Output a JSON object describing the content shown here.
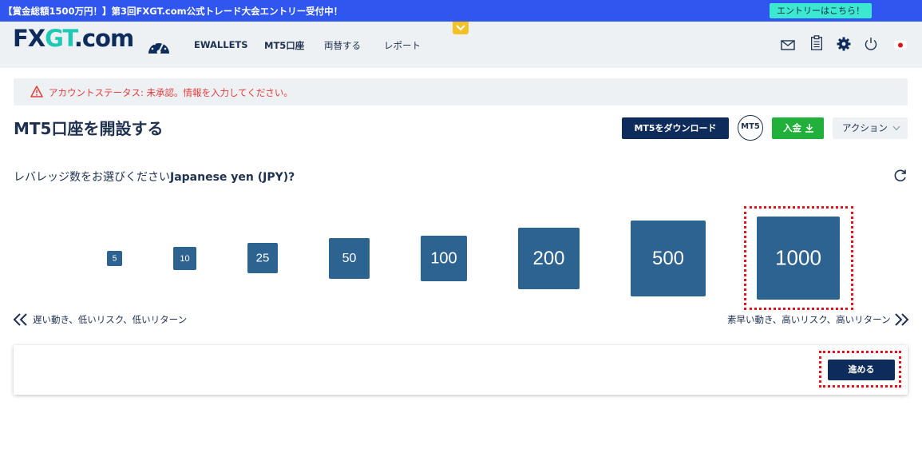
{
  "banner": {
    "text": "【賞金総額1500万円！】第3回FXGT.com公式トレード大会エントリー受付中！",
    "entry_button": "エントリーはこちら！"
  },
  "navbar": {
    "logo": {
      "fx": "FX",
      "gt": "GT",
      "com": ".com"
    },
    "items": [
      {
        "label": "EWALLETS"
      },
      {
        "label": "MT5口座"
      },
      {
        "label": "両替する"
      },
      {
        "label": "レポート"
      }
    ],
    "icons": [
      "dashboard-gauge-icon",
      "mail-icon",
      "clipboard-icon",
      "gear-icon",
      "power-icon",
      "japan-flag-icon"
    ]
  },
  "alert": {
    "text": "アカウントステータス: 未承認。情報を入力してください。"
  },
  "page": {
    "title": "MT5口座を開設する",
    "download_button": "MT5をダウンロード",
    "mt5_badge": "MT5",
    "deposit_button": "入金",
    "action_button": "アクション"
  },
  "leverage": {
    "question_prefix": "レバレッジ数をお選びください",
    "question_currency": "Japanese yen (JPY)?",
    "options": [
      {
        "label": "5",
        "selected": false
      },
      {
        "label": "10",
        "selected": false
      },
      {
        "label": "25",
        "selected": false
      },
      {
        "label": "50",
        "selected": false
      },
      {
        "label": "100",
        "selected": false
      },
      {
        "label": "200",
        "selected": false
      },
      {
        "label": "500",
        "selected": false
      },
      {
        "label": "1000",
        "selected": true
      }
    ],
    "scale_low": "遅い動き、低いリスク、低いリターン",
    "scale_high": "素早い動き、高いリスク、高いリターン"
  },
  "footer_card": {
    "next_button": "進める"
  },
  "colors": {
    "banner": "#2f57f0",
    "navy": "#0d2c5b",
    "tile": "#2c6391",
    "green": "#21b03a",
    "alert_text": "#e43b3b",
    "highlight": "#e4121b"
  }
}
